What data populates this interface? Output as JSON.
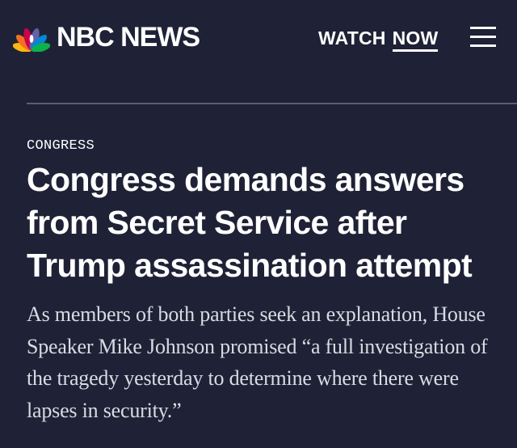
{
  "header": {
    "logo_text": "NBC NEWS",
    "logo_icon": "nbc-peacock-icon",
    "watch_label": "WATCH",
    "now_label": "NOW",
    "menu_icon": "hamburger-menu-icon"
  },
  "article": {
    "category": "CONGRESS",
    "headline": "Congress demands answers from Secret Service after Trump assassination attempt",
    "dek": "As members of both parties seek an explanation, House Speaker Mike Johnson promised “a full investigation of the tragedy yesterday to determine where there were lapses in security.”"
  },
  "colors": {
    "background": "#1f2236",
    "text": "#ffffff",
    "dek_text": "#d9dbe3",
    "divider": "#5a5f72",
    "peacock": [
      "#fcb711",
      "#f37021",
      "#cc004c",
      "#6460aa",
      "#0089d0",
      "#0db14b"
    ]
  }
}
